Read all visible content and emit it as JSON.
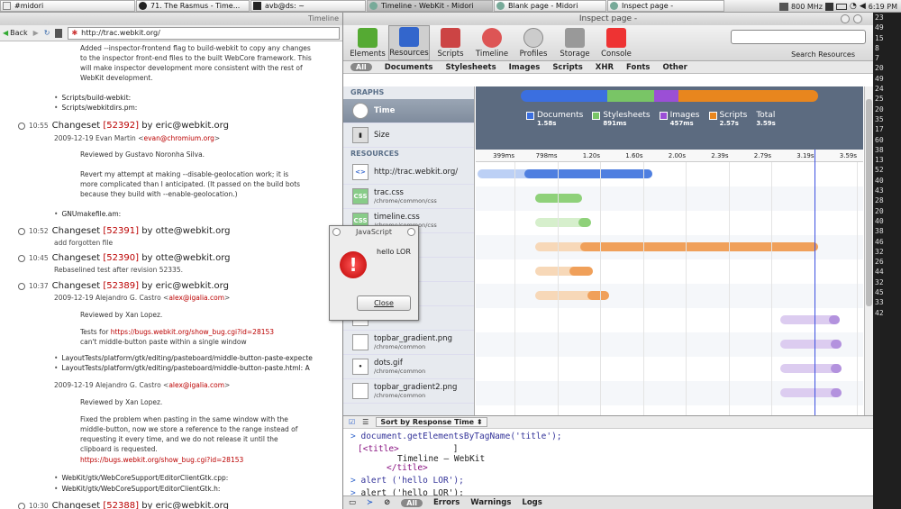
{
  "taskbar": {
    "tasks": [
      "#midori",
      "71. The Rasmus - Time...",
      "avb@ds: ~",
      "Timeline - WebKit - Midori",
      "Blank page - Midori",
      "Inspect page -"
    ],
    "cpu": "800 MHz",
    "clock": "6:19 PM"
  },
  "browser": {
    "title": "Timeline",
    "back_label": "Back",
    "url": "http://trac.webkit.org/",
    "top_text": [
      "Added --inspector-frontend flag to build-webkit to copy any changes",
      "to the inspector front-end files to the built WebCore framework. This",
      "will make inspector development more consistent with the rest of",
      "WebKit development."
    ],
    "top_bullets": [
      "Scripts/build-webkit:",
      "Scripts/webkitdirs.pm:"
    ],
    "cs1": {
      "time": "10:55",
      "label": "Changeset",
      "id": "[52392]",
      "by": "by eric@webkit.org",
      "author": "2009-12-19 Evan Martin <",
      "email": "evan@chromium.org",
      "lines": [
        "Reviewed by Gustavo Noronha Silva.",
        "Revert my attempt at making --disable-geolocation work; it is",
        "more complicated than I anticipated. (It passed on the build bots",
        "because they build with --enable-geolocation.)"
      ],
      "bullet": "GNUmakefile.am:"
    },
    "cs2": {
      "time": "10:52",
      "label": "Changeset",
      "id": "[52391]",
      "by": "by otte@webkit.org",
      "desc": "add forgotten file"
    },
    "cs3": {
      "time": "10:45",
      "label": "Changeset",
      "id": "[52390]",
      "by": "by otte@webkit.org",
      "desc": "Rebaselined test after revision 52335."
    },
    "cs4": {
      "time": "10:37",
      "label": "Changeset",
      "id": "[52389]",
      "by": "by eric@webkit.org",
      "author": "2009-12-19 Alejandro G. Castro <",
      "email": "alex@igalia.com",
      "l1": "Reviewed by Xan Lopez.",
      "l2a": "Tests for ",
      "l2b": "https://bugs.webkit.org/show_bug.cgi?id=28153",
      "l3": "can't middle-button paste within a single window",
      "b1": "LayoutTests/platform/gtk/editing/pasteboard/middle-button-paste-expecte",
      "b2": "LayoutTests/platform/gtk/editing/pasteboard/middle-button-paste.html: A",
      "author2": "2009-12-19 Alejandro G. Castro <",
      "email2": "alex@igalia.com",
      "l4": "Reviewed by Xan Lopez.",
      "l5": [
        "Fixed the problem when pasting in the same window with the",
        "middle-button, now we store a reference to the range instead of",
        "requesting it every time, and we do not release it until the",
        "clipboard is requested."
      ],
      "l6": "https://bugs.webkit.org/show_bug.cgi?id=28153",
      "b3": "WebKit/gtk/WebCoreSupport/EditorClientGtk.cpp:",
      "b4": "WebKit/gtk/WebCoreSupport/EditorClientGtk.h:"
    },
    "cs5": {
      "time": "10:30",
      "label": "Changeset",
      "id": "[52388]",
      "by": "by eric@webkit.org"
    }
  },
  "inspector": {
    "title": "Inspect page -",
    "toolbar": [
      "Elements",
      "Resources",
      "Scripts",
      "Timeline",
      "Profiles",
      "Storage",
      "Console"
    ],
    "search_label": "Search Resources",
    "filters": [
      "All",
      "Documents",
      "Stylesheets",
      "Images",
      "Scripts",
      "XHR",
      "Fonts",
      "Other"
    ],
    "graphs_header": "GRAPHS",
    "graph_items": [
      "Time",
      "Size"
    ],
    "resources_header": "RESOURCES",
    "resources": [
      {
        "name": "http://trac.webkit.org/",
        "path": "",
        "icon": "<>"
      },
      {
        "name": "trac.css",
        "path": "/chrome/common/css",
        "icon": "CSS"
      },
      {
        "name": "timeline.css",
        "path": "/chrome/common/css",
        "icon": "CSS"
      },
      {
        "name": "",
        "path": "on/js",
        "icon": ""
      },
      {
        "name": "",
        "path": "on/js",
        "icon": ""
      },
      {
        "name": "",
        "path": "on/js",
        "icon": ""
      },
      {
        "name": "",
        "path": "",
        "icon": ""
      },
      {
        "name": "topbar_gradient.png",
        "path": "/chrome/common",
        "icon": ""
      },
      {
        "name": "dots.gif",
        "path": "/chrome/common",
        "icon": "•"
      },
      {
        "name": "topbar_gradient2.png",
        "path": "/chrome/common",
        "icon": ""
      }
    ],
    "legend": [
      {
        "label": "Documents",
        "value": "1.58s",
        "color": "#3b6fe0"
      },
      {
        "label": "Stylesheets",
        "value": "891ms",
        "color": "#79c566"
      },
      {
        "label": "Images",
        "value": "457ms",
        "color": "#9b4fd6"
      },
      {
        "label": "Scripts",
        "value": "2.57s",
        "color": "#e8861e"
      },
      {
        "label": "Total",
        "value": "3.59s",
        "color": ""
      }
    ],
    "ticks": [
      "399ms",
      "798ms",
      "1.20s",
      "1.60s",
      "2.00s",
      "2.39s",
      "2.79s",
      "3.19s",
      "3.59s"
    ],
    "sort_label": "Sort by Response Time",
    "console_lines": {
      "cmd1": "document.getElementsByTagName('title');",
      "open": "[<title>",
      "close_bracket": "]",
      "title_text": "Timeline — WebKit",
      "close_tag": "</title>",
      "cmd2": "alert ('hello LOR');",
      "cmd3": "alert ('hello LOR');"
    },
    "footer": [
      "All",
      "Errors",
      "Warnings",
      "Logs"
    ]
  },
  "dialog": {
    "title": "JavaScript",
    "message": "hello LOR",
    "button": "Close"
  },
  "strip": [
    "23",
    "49",
    "15",
    "8",
    "7",
    "20",
    "49",
    "24",
    "25",
    "20",
    "35",
    "17",
    "60",
    "38",
    "13",
    "52",
    "40",
    "43",
    "28",
    "20",
    "40",
    "38",
    "46",
    "32",
    "26",
    "44",
    "32",
    "45",
    "33",
    "42"
  ]
}
